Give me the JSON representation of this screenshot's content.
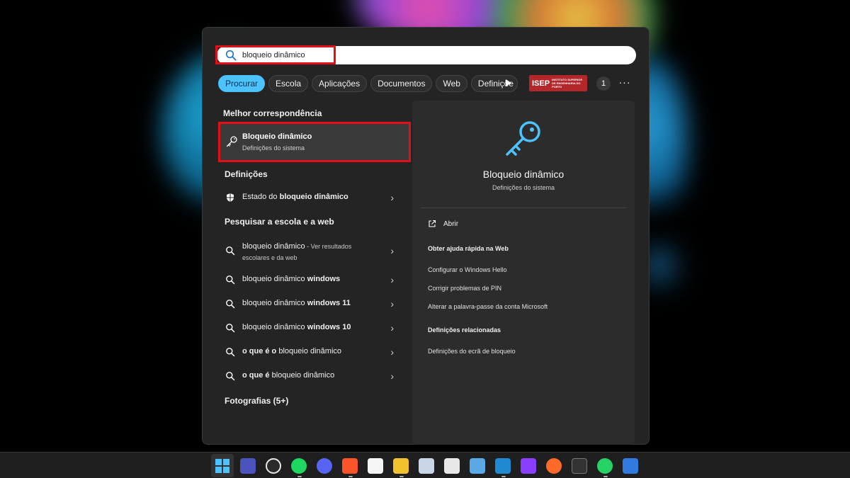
{
  "search": {
    "value": "bloqueio dinâmico"
  },
  "tabs": [
    "Procurar",
    "Escola",
    "Aplicações",
    "Documentos",
    "Web",
    "Definiçõe"
  ],
  "header": {
    "isep_main": "ISEP",
    "isep_sub_1": "INSTITUTO SUPERIOR",
    "isep_sub_2": "DE ENGENHARIA DO PORTO",
    "badge_count": "1",
    "more": "···"
  },
  "best_match": {
    "section": "Melhor correspondência",
    "title": "Bloqueio dinâmico",
    "subtitle": "Definições do sistema"
  },
  "settings": {
    "section": "Definições",
    "item_plain": "Estado do ",
    "item_bold": "bloqueio dinâmico"
  },
  "web": {
    "section": "Pesquisar a escola e a web",
    "first": {
      "text": "bloqueio dinâmico",
      "hint": " - Ver resultados escolares e da web"
    },
    "items": [
      {
        "plain": "bloqueio dinâmico ",
        "bold": "windows"
      },
      {
        "plain": "bloqueio dinâmico ",
        "bold": "windows 11"
      },
      {
        "plain": "bloqueio dinâmico ",
        "bold": "windows 10"
      },
      {
        "bold1": "o que é o",
        "plain": " bloqueio dinâmico"
      },
      {
        "bold1": "o que é",
        "plain": " bloqueio dinâmico"
      }
    ]
  },
  "photos": {
    "section": "Fotografias (5+)"
  },
  "preview": {
    "title": "Bloqueio dinâmico",
    "subtitle": "Definições do sistema",
    "open": "Abrir",
    "help_head": "Obter ajuda rápida na Web",
    "help_links": [
      "Configurar o Windows Hello",
      "Corrigir problemas de PIN",
      "Alterar a palavra-passe da conta Microsoft"
    ],
    "related_head": "Definições relacionadas",
    "related_links": [
      "Definições do ecrã de bloqueio"
    ]
  },
  "colors": {
    "accent": "#4cc2ff",
    "highlight": "#e3101a",
    "panel": "#242424"
  }
}
